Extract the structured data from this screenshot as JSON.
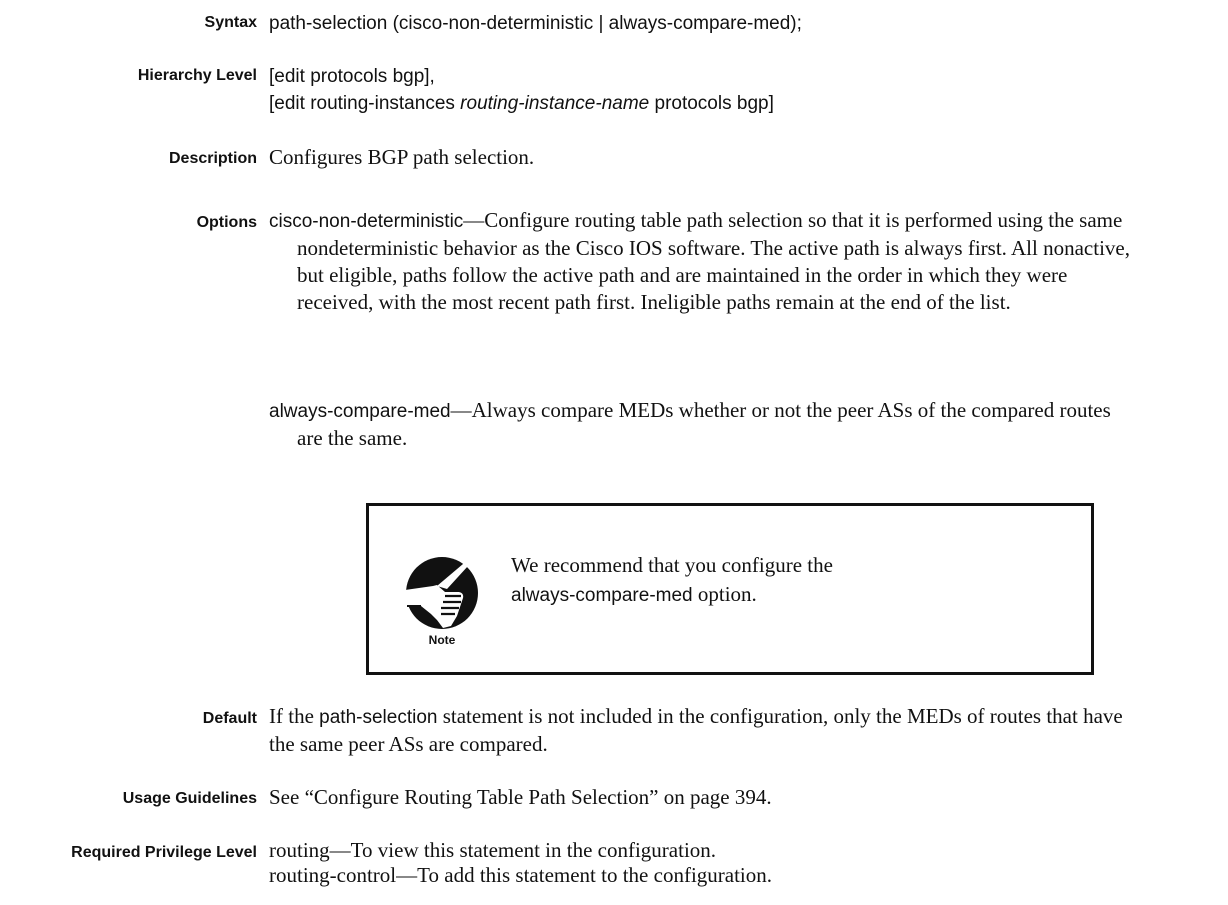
{
  "syntax": {
    "label": "Syntax",
    "text": "path-selection (cisco-non-deterministic | always-compare-med);"
  },
  "hierarchy": {
    "label": "Hierarchy Level",
    "line1": "[edit protocols bgp],",
    "line2_pre": "[edit routing-instances ",
    "line2_ital": "routing-instance-name",
    "line2_post": " protocols bgp]"
  },
  "description": {
    "label": "Description",
    "text": "Configures BGP path selection."
  },
  "options": {
    "label": "Options",
    "items": [
      {
        "term": "cisco-non-deterministic",
        "text": "—Configure routing table path selection so that it is performed using the same nondeterministic behavior as the Cisco IOS software. The active path is always first. All nonactive, but eligible, paths follow the active path and are maintained in the order in which they were received, with the most recent path first. Ineligible paths remain at the end of the list."
      },
      {
        "term": "always-compare-med",
        "text": "—Always compare MEDs whether or not the peer ASs of the compared routes are the same."
      }
    ]
  },
  "note": {
    "icon_label": "Note",
    "text_pre": "We recommend that you configure the",
    "term": "always-compare-med",
    "text_post": " option.",
    "icon": "pointing-hand-icon"
  },
  "default": {
    "label": "Default",
    "pre": "If the ",
    "term": "path-selection",
    "post": " statement is not included in the configuration, only the MEDs of routes that have the same peer ASs are compared."
  },
  "usage": {
    "label": "Usage Guidelines",
    "text": "See “Configure Routing Table Path Selection” on page 394."
  },
  "privilege": {
    "label": "Required Privilege Level",
    "line1_term": "routing",
    "line1_text": "—To view this statement in the configuration.",
    "line2_term": "routing-control",
    "line2_text": "—To add this statement to the configuration."
  }
}
